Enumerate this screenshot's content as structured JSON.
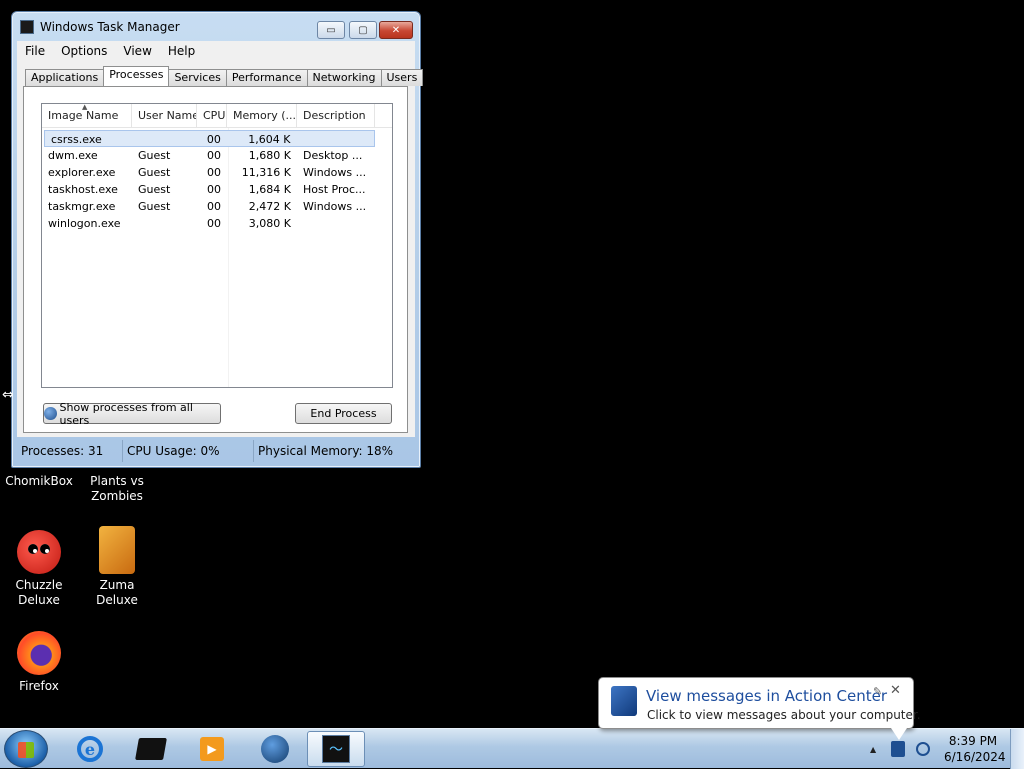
{
  "window": {
    "title": "Windows Task Manager",
    "controls": {
      "minimize": "▭",
      "maximize": "▢",
      "close": "✕"
    },
    "menu": [
      "File",
      "Options",
      "View",
      "Help"
    ],
    "tabs": [
      "Applications",
      "Processes",
      "Services",
      "Performance",
      "Networking",
      "Users"
    ],
    "active_tab": "Processes"
  },
  "process_list": {
    "columns": [
      "Image Name",
      "User Name",
      "CPU",
      "Memory (...",
      "Description"
    ],
    "rows": [
      {
        "image": "csrss.exe",
        "user": "",
        "cpu": "00",
        "memory": "1,604 K",
        "description": ""
      },
      {
        "image": "dwm.exe",
        "user": "Guest",
        "cpu": "00",
        "memory": "1,680 K",
        "description": "Desktop ..."
      },
      {
        "image": "explorer.exe",
        "user": "Guest",
        "cpu": "00",
        "memory": "11,316 K",
        "description": "Windows ..."
      },
      {
        "image": "taskhost.exe",
        "user": "Guest",
        "cpu": "00",
        "memory": "1,684 K",
        "description": "Host Proc..."
      },
      {
        "image": "taskmgr.exe",
        "user": "Guest",
        "cpu": "00",
        "memory": "2,472 K",
        "description": "Windows ..."
      },
      {
        "image": "winlogon.exe",
        "user": "",
        "cpu": "00",
        "memory": "3,080 K",
        "description": ""
      }
    ]
  },
  "buttons": {
    "show_all": "Show processes from all users",
    "end_process": "End Process"
  },
  "statusbar": {
    "processes": "Processes: 31",
    "cpu": "CPU Usage: 0%",
    "memory": "Physical Memory: 18%"
  },
  "desktop_icons": {
    "chomikbox": "ChomikBox",
    "plants": "Plants vs Zombies",
    "chuzzle": "Chuzzle Deluxe",
    "zuma": "Zuma Deluxe",
    "firefox": "Firefox"
  },
  "taskbar": {
    "ie_glyph": "e",
    "media_glyph": "▶",
    "taskmgr_glyph": "〜"
  },
  "notification": {
    "title": "View messages in Action Center",
    "text": "Click to view messages about your computer.",
    "close": "✕",
    "pin": "✎"
  },
  "clock": {
    "time": "8:39 PM",
    "date": "6/16/2024"
  },
  "colors": {
    "selection": "#dde9f8",
    "balloon_title": "#1e4e9e"
  }
}
